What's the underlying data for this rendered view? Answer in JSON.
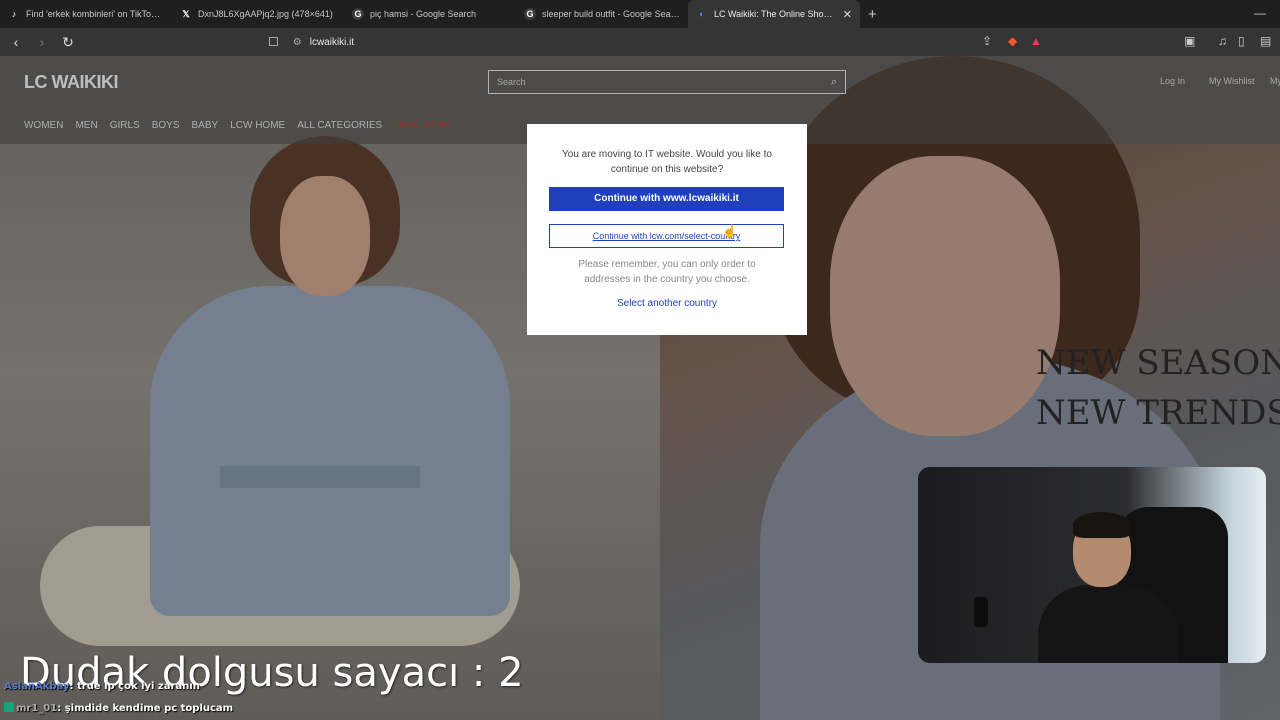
{
  "browser": {
    "tabs": [
      {
        "title": "Find 'erkek kombinleri' on TikTok | Ti",
        "favicon": "tiktok-icon",
        "active": false
      },
      {
        "title": "DxnJ8L6XgAAPjq2.jpg (478×641)",
        "favicon": "x-icon",
        "active": false
      },
      {
        "title": "piç hamsi - Google Search",
        "favicon": "google-icon",
        "active": false
      },
      {
        "title": "sleeper build outfit - Google Search",
        "favicon": "google-icon",
        "active": false
      },
      {
        "title": "LC Waikiki: The Online Shopping",
        "favicon": "lcw-icon",
        "active": true
      }
    ],
    "url": "lcwaikiki.it"
  },
  "site": {
    "logo": "LC WAIKIKI",
    "search_placeholder": "Search",
    "header_links": [
      "Log In",
      "My Wishlist",
      "My"
    ],
    "categories": [
      "WOMEN",
      "MEN",
      "GIRLS",
      "BOYS",
      "BABY",
      "LCW HOME",
      "ALL CATEGORIES",
      "DEAL ZONE"
    ],
    "hero_line1": "NEW SEASON",
    "hero_line2": "NEW TRENDS"
  },
  "modal": {
    "message": "You are moving to IT website. Would you like to continue on this website?",
    "primary_button": "Continue with www.lcwaikiki.it",
    "secondary_button": "Continue with lcw.com/select-country",
    "note": "Please remember, you can only order to addresses in the country you choose.",
    "link": "Select another country"
  },
  "stream": {
    "counter_text": "Dudak dolgusu  sayacı : 2",
    "chat": [
      {
        "user": "AslanAkbay",
        "message": ": true ıp çok iyi zaranın"
      },
      {
        "user": "mr1_01",
        "message": ": şimdide kendime pc toplucam"
      }
    ]
  },
  "colors": {
    "primary_button": "#1f3fbe",
    "deal_zone": "#c0392b"
  }
}
